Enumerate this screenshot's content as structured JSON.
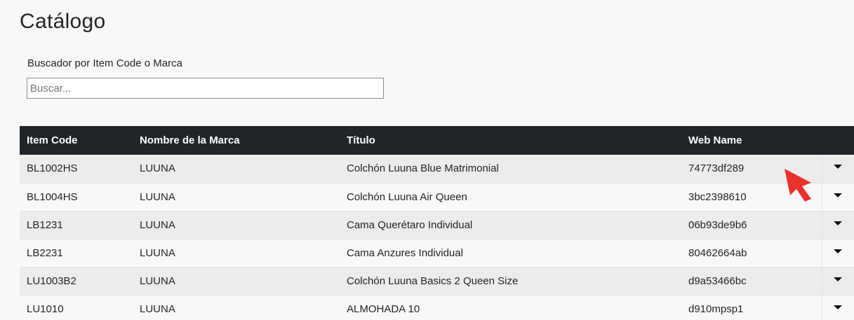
{
  "page": {
    "title": "Catálogo"
  },
  "search": {
    "label": "Buscador por Item Code o Marca",
    "placeholder": "Buscar...",
    "value": ""
  },
  "table": {
    "headers": [
      "Item Code",
      "Nombre de la Marca",
      "Título",
      "Web Name",
      ""
    ],
    "rows": [
      {
        "item_code": "BL1002HS",
        "brand": "LUUNA",
        "title": "Colchón Luuna Blue Matrimonial",
        "web_name": "74773df289"
      },
      {
        "item_code": "BL1004HS",
        "brand": "LUUNA",
        "title": "Colchón Luuna Air Queen",
        "web_name": "3bc2398610"
      },
      {
        "item_code": "LB1231",
        "brand": "LUUNA",
        "title": "Cama Querétaro Individual",
        "web_name": "06b93de9b6"
      },
      {
        "item_code": "LB2231",
        "brand": "LUUNA",
        "title": "Cama Anzures Individual",
        "web_name": "80462664ab"
      },
      {
        "item_code": "LU1003B2",
        "brand": "LUUNA",
        "title": "Colchón Luuna Basics 2 Queen Size",
        "web_name": "d9a53466bc"
      },
      {
        "item_code": "LU1010",
        "brand": "LUUNA",
        "title": "ALMOHADA 10",
        "web_name": "d910mpsp1"
      }
    ]
  },
  "colors": {
    "header_bg": "#212529",
    "cursor": "#e8322b"
  },
  "icons": {
    "row_action": "caret-down-icon",
    "pointer": "mouse-cursor-icon"
  }
}
